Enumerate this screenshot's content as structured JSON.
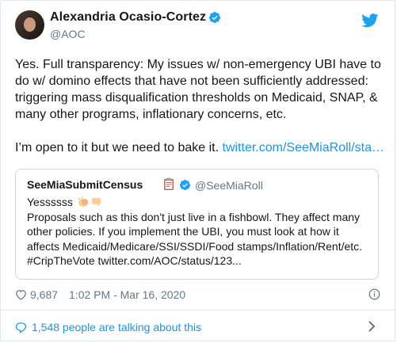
{
  "author": {
    "name": "Alexandria Ocasio-Cortez",
    "handle": "@AOC",
    "verified": true,
    "avatar_icon": "profile-photo"
  },
  "tweet": {
    "paragraph1": "Yes. Full transparency: My issues w/ non-emergency UBI have to do w/ domino effects that have not been sufficiently addressed: triggering mass disqualification thresholds on Medicaid, SNAP, & many other programs, inflationary concerns, etc.",
    "paragraph2_text": "I’m open to it but we need to bake it. ",
    "paragraph2_link": "twitter.com/SeeMiaRoll/sta…"
  },
  "quoted": {
    "name": "SeeMiaSubmitCensus",
    "name_emoji": "clipboard-icon",
    "handle": "@SeeMiaRoll",
    "verified": true,
    "line1": "Yessssss",
    "line1_emoji": "clapping-hands-and-pointing-down",
    "body": "Proposals such as this don't just live in a fishbowl. They affect many other policies. If you implement the UBI, you must look at how it affects Medicaid/Medicare/SSI/SSDI/Food stamps/Inflation/Rent/etc. #CripTheVote twitter.com/AOC/status/123..."
  },
  "meta": {
    "likes": "9,687",
    "time": "1:02 PM - Mar 16, 2020"
  },
  "footer": {
    "talking": "1,548 people are talking about this"
  },
  "colors": {
    "link": "#1b95e0",
    "muted": "#657786",
    "verified": "#1da1f2"
  }
}
